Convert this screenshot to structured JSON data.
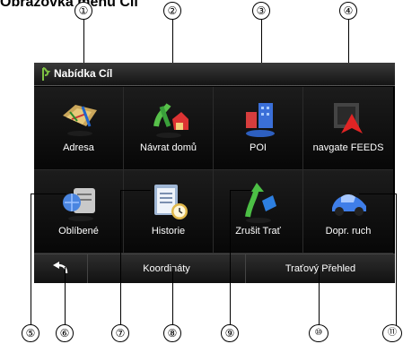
{
  "heading": "Obrazovka menu Cíl",
  "callouts_top": [
    "①",
    "②",
    "③",
    "④"
  ],
  "callouts_bottom": [
    "⑤",
    "⑥",
    "⑦",
    "⑧",
    "⑨",
    "⑩",
    "⑪"
  ],
  "screen": {
    "title": "Nabídka Cíl",
    "title_icon": "flag-icon",
    "items": [
      {
        "label": "Adresa",
        "icon": "map-pin-icon"
      },
      {
        "label": "Návrat domů",
        "icon": "home-icon"
      },
      {
        "label": "POI",
        "icon": "poi-building-icon"
      },
      {
        "label": "navgate FEEDS",
        "icon": "feeds-arrow-icon"
      },
      {
        "label": "Oblíbené",
        "icon": "favorites-globe-icon"
      },
      {
        "label": "Historie",
        "icon": "history-clipboard-icon"
      },
      {
        "label": "Zrušit Trať",
        "icon": "cancel-route-icon"
      },
      {
        "label": "Dopr. ruch",
        "icon": "traffic-car-icon"
      }
    ],
    "bottom": {
      "back_icon": "back-arrow-icon",
      "coordinates_label": "Koordináty",
      "route_overview_label": "Traťový Přehled"
    }
  }
}
